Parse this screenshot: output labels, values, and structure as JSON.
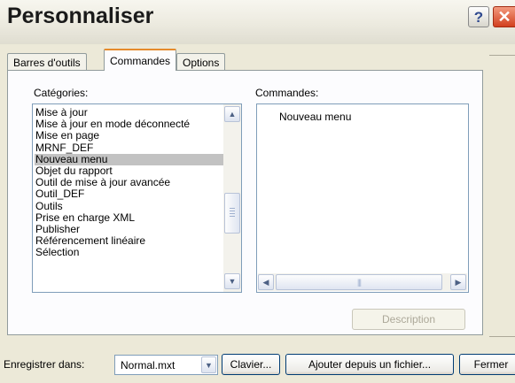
{
  "window": {
    "title": "Personnaliser",
    "help_label": "?",
    "close_label": "✕"
  },
  "tabs": [
    {
      "label": "Barres d'outils"
    },
    {
      "label": "Commandes",
      "selected": true
    },
    {
      "label": "Options"
    }
  ],
  "categories": {
    "label": "Catégories:",
    "selected": "Nouveau menu",
    "items": [
      "Mise à jour",
      "Mise à jour en mode déconnecté",
      "Mise en page",
      "MRNF_DEF",
      "Nouveau menu",
      "Objet du rapport",
      "Outil de mise à jour avancée",
      "Outil_DEF",
      "Outils",
      "Prise en charge XML",
      "Publisher",
      "Référencement linéaire",
      "Sélection"
    ]
  },
  "commands": {
    "label": "Commandes:",
    "items": [
      "Nouveau menu"
    ]
  },
  "description_button": "Description",
  "bottom": {
    "save_in_label": "Enregistrer dans:",
    "save_in_value": "Normal.mxt",
    "keyboard_button": "Clavier...",
    "add_from_file_button": "Ajouter depuis un fichier...",
    "close_button": "Fermer"
  },
  "colors": {
    "dialog_bg": "#ece9d8",
    "selection": "#c2c2c2",
    "tab_accent": "#e68b2c",
    "close_button": "#d2401f"
  }
}
